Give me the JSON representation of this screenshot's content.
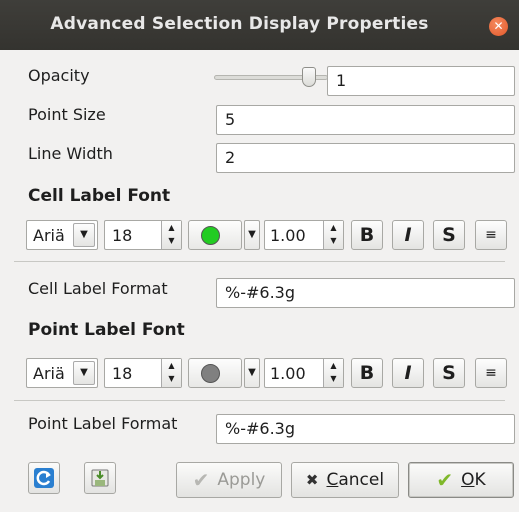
{
  "window": {
    "title": "Advanced Selection Display Properties",
    "close_glyph": "✕"
  },
  "fields": {
    "opacity": {
      "label": "Opacity",
      "value": "1",
      "slider_level": 1.0
    },
    "point_size": {
      "label": "Point Size",
      "value": "5"
    },
    "line_width": {
      "label": "Line Width",
      "value": "2"
    }
  },
  "cell_label_font": {
    "heading": "Cell Label Font",
    "font_family": "Ariä",
    "font_size": "18",
    "color": "#22cc22",
    "opacity": "1.00",
    "bold_label": "B",
    "italic_label": "I",
    "shadow_label": "S"
  },
  "cell_label_format": {
    "label": "Cell Label Format",
    "value": "%-#6.3g"
  },
  "point_label_font": {
    "heading": "Point Label Font",
    "font_family": "Ariä",
    "font_size": "18",
    "color": "#808080",
    "opacity": "1.00",
    "bold_label": "B",
    "italic_label": "I",
    "shadow_label": "S"
  },
  "point_label_format": {
    "label": "Point Label Format",
    "value": "%-#6.3g"
  },
  "buttons": {
    "apply": "Apply",
    "cancel_prefix": "",
    "cancel_underlined": "C",
    "cancel_rest": "ancel",
    "ok_underlined": "O",
    "ok_rest": "K"
  },
  "icons": {
    "reset": "refresh-icon",
    "save_default": "save-icon",
    "apply": "checkmark-icon",
    "cancel": "x-icon",
    "ok": "checkmark-icon",
    "justify": "justify-icon"
  },
  "colors": {
    "apply_check": "#b7b7b3",
    "cancel_x": "#333333",
    "ok_check": "#7fb82a",
    "refresh": "#2a7fd0"
  }
}
